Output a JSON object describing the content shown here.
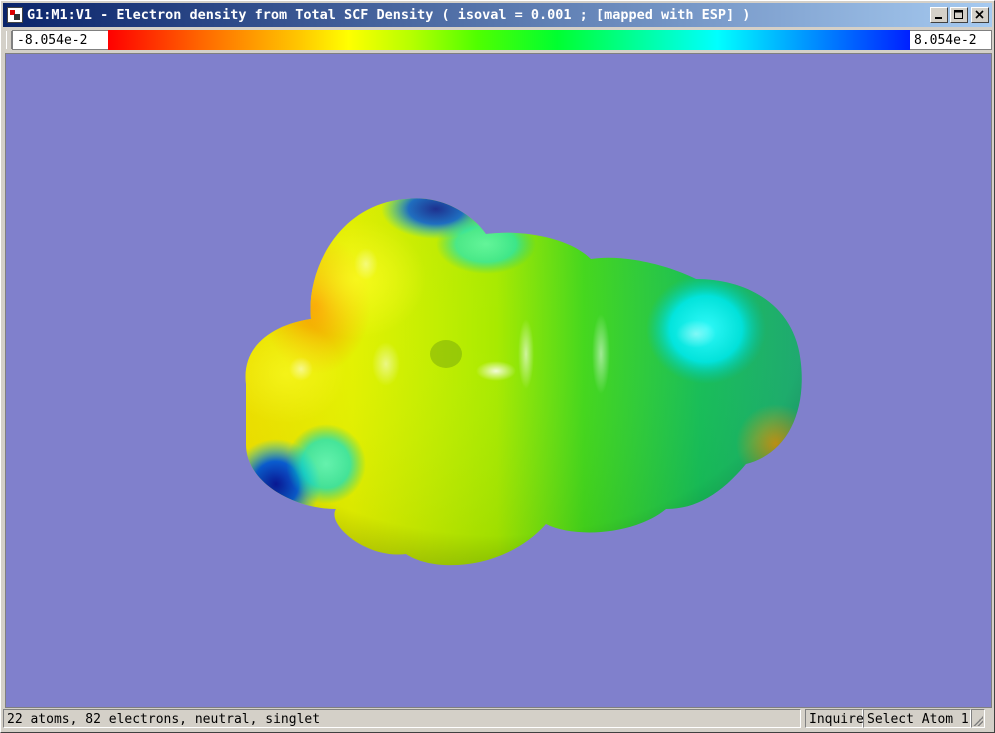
{
  "window": {
    "title": "G1:M1:V1 - Electron density from Total SCF Density ( isoval = 0.001 ; [mapped with ESP] )",
    "icon": "gaussview-app-icon",
    "controls": {
      "minimize": "_",
      "maximize": "□",
      "close": "✕"
    }
  },
  "colorbar": {
    "min_label": "-8.054e-2",
    "max_label": "8.054e-2",
    "gradient_colors": [
      "#ff0000",
      "#ffff00",
      "#00ff00",
      "#00ffff",
      "#0000ff"
    ]
  },
  "viewport": {
    "background": "#8080cc",
    "surface": "ESP-mapped electron density isosurface"
  },
  "status": {
    "info": "22 atoms, 82 electrons, neutral, singlet",
    "mode": "Inquire",
    "action": "Select Atom 1"
  }
}
